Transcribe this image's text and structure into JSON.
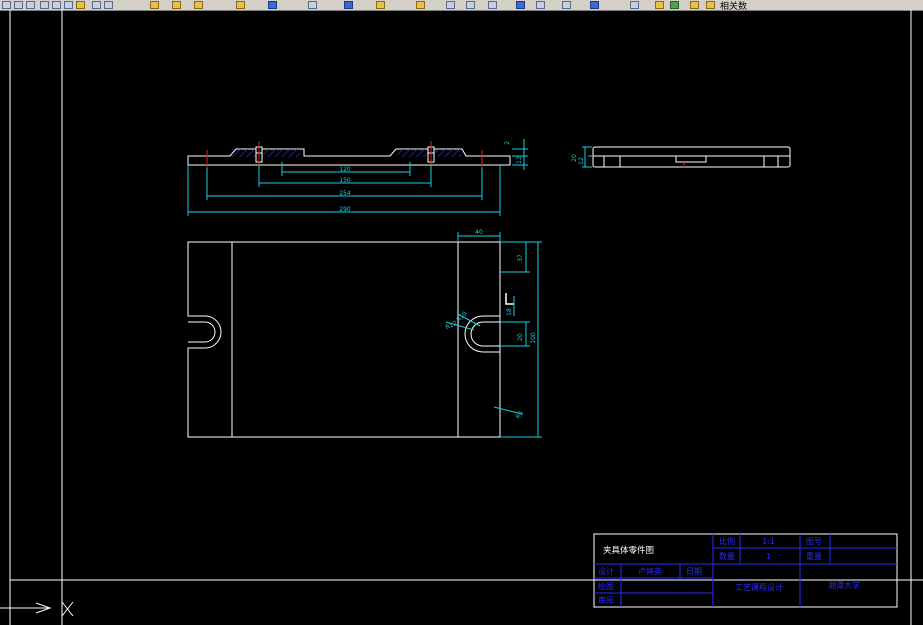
{
  "toolbar": {
    "layer_name": "相关数",
    "icons": [
      "save-icon",
      "print-icon",
      "preview-icon",
      "cut-icon",
      "copy-icon",
      "paste-icon",
      "match-properties-icon",
      "undo-icon",
      "redo-icon",
      "pan-icon",
      "zoom-realtime-icon",
      "zoom-window-icon",
      "zoom-previous-icon",
      "text-style-icon",
      "table-icon",
      "layer-properties-icon",
      "layer-state-icon",
      "bulb-icon",
      "sun-icon",
      "lock-icon"
    ]
  },
  "drawing": {
    "dims": {
      "d120": "120",
      "d150": "150",
      "d254": "254",
      "d290": "290",
      "d40": "40",
      "d37": "37",
      "d18": "18",
      "d20": "20",
      "d100": "100",
      "d2": "2",
      "d12": "12",
      "side20": "20",
      "side12": "12",
      "r12": "R12",
      "r10": "R10",
      "r5": "R5"
    },
    "title_block": {
      "drawing_name": "夹具体零件图",
      "scale_label": "比例",
      "scale_value": "1:1",
      "drawing_no_label": "图号",
      "quantity_label": "数量",
      "quantity_value": "1",
      "weight_label": "重量",
      "designer_label": "设计",
      "designer_name": "卢婷英",
      "date_label": "日期",
      "drafter_label": "绘图",
      "reviewer_label": "审阅",
      "course_title": "工艺课程设计",
      "school": "湘潭大学"
    }
  }
}
